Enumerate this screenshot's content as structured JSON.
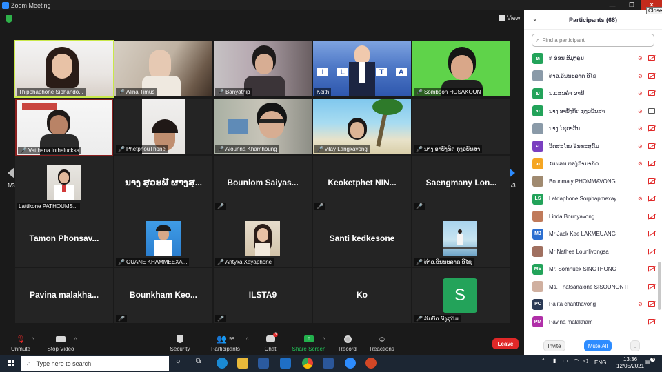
{
  "window": {
    "title": "Zoom Meeting",
    "close_tooltip": "Close"
  },
  "view_label": "View",
  "page_nav": {
    "left": "1/3",
    "right": "1/3"
  },
  "tiles": [
    {
      "name": "Thipphaphone Siphando...",
      "type": "video"
    },
    {
      "name": "Alina Timus",
      "type": "video"
    },
    {
      "name": "Banyathip",
      "type": "video"
    },
    {
      "name": "Keith",
      "type": "video",
      "banner": "ILSTA"
    },
    {
      "name": "Somboon HOSAKOUN",
      "type": "video"
    },
    {
      "name": "Vatthana Inthalucksa",
      "type": "video"
    },
    {
      "name": "PhetphouThone",
      "type": "video"
    },
    {
      "name": "Alounna Khamhoung",
      "type": "video"
    },
    {
      "name": "vilay Langkavong",
      "type": "video"
    },
    {
      "name": "ນາງ ອາບັງທິດ ກຸງວບັນສາ",
      "type": "empty"
    },
    {
      "name": "Lattikone PATHOUMS...",
      "type": "thumb"
    },
    {
      "big": "ນາງ ສຸວະພີ ຜາງສຸ...",
      "type": "text"
    },
    {
      "big": "Bounlom Saiyas...",
      "type": "text"
    },
    {
      "big": "Keoketphet NIN...",
      "type": "text"
    },
    {
      "big": "Saengmany Lon...",
      "type": "text"
    },
    {
      "big": "Tamon Phonsav...",
      "type": "text"
    },
    {
      "name": "OUANE KHAMMEEXA...",
      "type": "thumb"
    },
    {
      "name": "Antyka Xayaphone",
      "type": "thumb"
    },
    {
      "big": "Santi kedkesone",
      "type": "text"
    },
    {
      "name": "ທ້າວ.ອິນທະລາດ ອີໄຊ",
      "type": "thumb"
    },
    {
      "big": "Pavina malakha...",
      "type": "text"
    },
    {
      "big": "Bounkham Keo...",
      "type": "text"
    },
    {
      "big": "ILSTA9",
      "type": "text"
    },
    {
      "big": "Ko",
      "type": "text"
    },
    {
      "name": "ສົມບັດ ພົງສຸດົມ",
      "type": "letter",
      "letter": "S"
    }
  ],
  "toolbar": {
    "unmute": "Unmute",
    "stop_video": "Stop Video",
    "security": "Security",
    "participants": "Participants",
    "participants_count": "98",
    "chat": "Chat",
    "chat_badge": "3",
    "share": "Share Screen",
    "record": "Record",
    "reactions": "Reactions",
    "leave": "Leave"
  },
  "panel": {
    "title": "Participants (68)",
    "search_placeholder": "Find a participant",
    "invite": "Invite",
    "mute_all": "Mute All",
    "more": "..",
    "participants": [
      {
        "initials": "ທ",
        "name": "ທ ອ່ອນ ສີມຸງຄູນ",
        "color": "#23a35a",
        "cam": "off"
      },
      {
        "initials": "",
        "name": "ທ້າວ.ອິນທະລາດ ອີໄຊ",
        "color": "#8a9aa8",
        "cam": "off"
      },
      {
        "initials": "ນ",
        "name": "ນ.ແສນຄຳ ຜານີ",
        "color": "#23a35a",
        "cam": "off"
      },
      {
        "initials": "ນ",
        "name": "ນາງ ອາບັງທິດ ກຸງວບັນສາ",
        "color": "#23a35a",
        "cam": "on"
      },
      {
        "initials": "",
        "name": "ນາງ ໄຊດາວັນ",
        "color": "#8a9aa8",
        "cam": "off"
      },
      {
        "initials": "ວ",
        "name": "ວິດສະໄໝ ອິນທະສຸດົມ",
        "color": "#7a3fc0",
        "cam": "off"
      },
      {
        "initials": "ມ",
        "name": "ໄມພອນ ທອງໍກ້າມາຄິດ",
        "color": "#f5a623",
        "cam": "off"
      },
      {
        "initials": "",
        "name": "Bounmaiy PHOMMAVONG",
        "color": "#a08a70",
        "cam": "off",
        "nomic": true
      },
      {
        "initials": "LS",
        "name": "Latdaphone Sorphapmexay",
        "color": "#23a35a",
        "cam": "off"
      },
      {
        "initials": "",
        "name": "Linda Bounyavong",
        "color": "#c07a5a",
        "cam": "off",
        "nomic": true
      },
      {
        "initials": "MJ",
        "name": "Mr Jack Kee LAKMEUANG",
        "color": "#2d6fd0",
        "cam": "off",
        "nomic": true
      },
      {
        "initials": "",
        "name": "Mr Nathee Lounlivongsa",
        "color": "#a07060",
        "cam": "off",
        "nomic": true
      },
      {
        "initials": "MS",
        "name": "Mr. Somnuek SINGTHONG",
        "color": "#23a35a",
        "cam": "off",
        "nomic": true
      },
      {
        "initials": "",
        "name": "Ms. Thatsanalone SISOUNONTH",
        "color": "#d0b0a0",
        "cam": "off",
        "nomic": true
      },
      {
        "initials": "PC",
        "name": "Palita chanthavong",
        "color": "#2b3a55",
        "cam": "off"
      },
      {
        "initials": "PM",
        "name": "Pavina malakham",
        "color": "#b02fa8",
        "cam": "off",
        "nomic": true
      }
    ]
  },
  "taskbar": {
    "search_placeholder": "Type here to search",
    "time": "13:36",
    "date": "12/05/2021",
    "lang": "ENG",
    "notif_count": "3"
  },
  "colors": {
    "accent": "#2d8cff",
    "leave": "#e02828",
    "mic_off": "#e02828",
    "active_speaker": "#c9e84a"
  }
}
